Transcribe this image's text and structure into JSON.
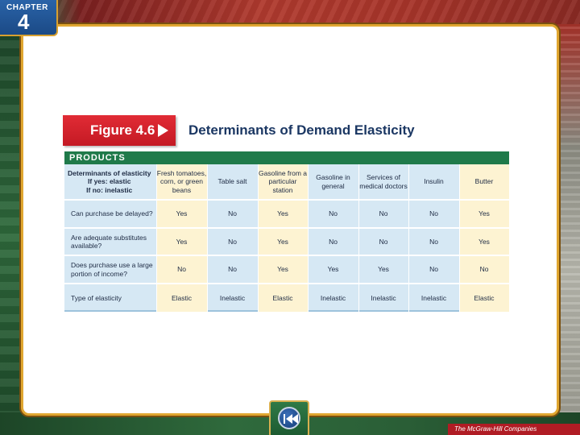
{
  "chapter": {
    "label": "CHAPTER",
    "number": "4"
  },
  "figure": {
    "tab_label": "Figure 4.6",
    "title": "Determinants of Demand Elasticity"
  },
  "products_label": "PRODUCTS",
  "table": {
    "header_line1": "Determinants of elasticity",
    "header_line2": "If yes: elastic",
    "header_line3": "If no: inelastic",
    "columns": [
      "Fresh tomatoes, corn, or green beans",
      "Table salt",
      "Gasoline from a particular station",
      "Gasoline in general",
      "Services of medical doctors",
      "Insulin",
      "Butter"
    ],
    "rows": [
      {
        "label": "Can purchase be delayed?",
        "values": [
          "Yes",
          "No",
          "Yes",
          "No",
          "No",
          "No",
          "Yes"
        ]
      },
      {
        "label": "Are adequate substitutes available?",
        "values": [
          "Yes",
          "No",
          "Yes",
          "No",
          "No",
          "No",
          "Yes"
        ]
      },
      {
        "label": "Does purchase use a large portion of income?",
        "values": [
          "No",
          "No",
          "Yes",
          "Yes",
          "Yes",
          "No",
          "No"
        ]
      },
      {
        "label": "Type of elasticity",
        "values": [
          "Elastic",
          "Inelastic",
          "Elastic",
          "Inelastic",
          "Inelastic",
          "Inelastic",
          "Elastic"
        ]
      }
    ]
  },
  "publisher": "The McGraw-Hill Companies",
  "colors": {
    "figure_tab": "#d9222c",
    "title_text": "#1b3763",
    "products_bar": "#1f7a4a",
    "table_blue": "#d6e8f4",
    "table_highlight": "#fdf3d2",
    "frame_gold": "#e0a630"
  },
  "icons": {
    "back": "rewind-icon"
  }
}
